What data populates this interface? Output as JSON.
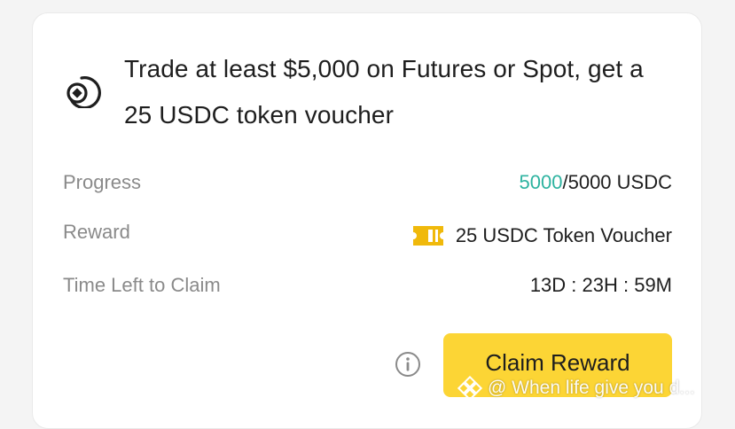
{
  "task": {
    "title": "Trade at least $5,000 on Futures or Spot, get a 25 USDC token voucher",
    "icon": "target-coin-icon"
  },
  "rows": {
    "progress": {
      "label": "Progress",
      "current": "5000",
      "total": "/5000 USDC"
    },
    "reward": {
      "label": "Reward",
      "value": "25 USDC Token Voucher",
      "icon": "voucher-ticket-icon"
    },
    "time_left": {
      "label": "Time Left to Claim",
      "value": "13D : 23H : 59M"
    }
  },
  "actions": {
    "claim_label": "Claim Reward",
    "info_icon": "info-icon"
  },
  "watermark": {
    "text": "@ When life give you d...",
    "icon": "binance-logo-icon"
  },
  "colors": {
    "accent_yellow": "#FCD535",
    "progress_teal": "#2DB3A0",
    "label_gray": "#8A8A8A",
    "text_dark": "#1E1E1E"
  }
}
